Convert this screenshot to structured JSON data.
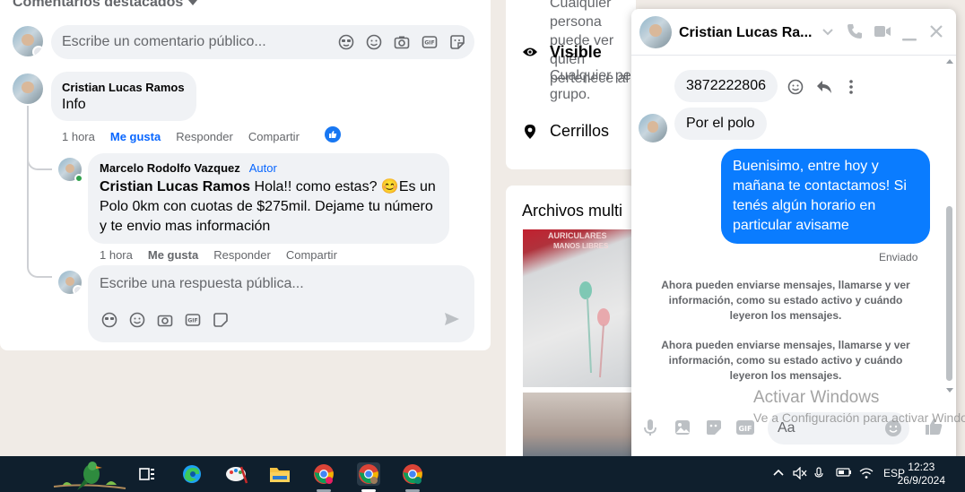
{
  "feed": {
    "section_header": "Comentarios destacados",
    "comment_placeholder": "Escribe un comentario público...",
    "comment1": {
      "author": "Cristian Lucas Ramos",
      "text": "Info",
      "time": "1 hora",
      "like": "Me gusta",
      "reply": "Responder",
      "share": "Compartir"
    },
    "comment2": {
      "author": "Marcelo Rodolfo Vazquez",
      "badge": "Autor",
      "mention": "Cristian Lucas Ramos",
      "text": " Hola!! como estas? 😊Es un Polo 0km con cuotas de $275mil. Dejame tu número y te envio mas información",
      "time": "1 hora",
      "like": "Me gusta",
      "reply": "Responder",
      "share": "Compartir"
    },
    "reply_placeholder": "Escribe una respuesta pública..."
  },
  "group_info": {
    "line_top1": "Cualquier persona puede ver quién",
    "line_top2": "pertenece al",
    "visible_title": "Visible",
    "visible_line1": "Cualquier pe",
    "visible_line2": "grupo.",
    "location": "Cerrillos",
    "media_title": "Archivos multi",
    "photo_text1": "AURICULARES",
    "photo_text2": "MANOS LIBRES"
  },
  "chat": {
    "name": "Cristian Lucas Ra...",
    "msg_phone": "3872222806",
    "msg_polo": "Por el polo",
    "msg_out": "Buenisimo, entre hoy y mañana te contactamos! Si tenés algún horario en particular avisame",
    "sent_status": "Enviado",
    "system1": "Ahora pueden enviarse mensajes, llamarse y ver información, como su estado activo y cuándo leyeron los mensajes.",
    "system2": "Ahora pueden enviarse mensajes, llamarse y ver información, como su estado activo y cuándo leyeron los mensajes.",
    "composer_placeholder": "Aa"
  },
  "watermark": {
    "title": "Activar Windows",
    "subtitle": "Ve a Configuración para activar Windows."
  },
  "taskbar": {
    "language": "ESP",
    "time": "12:23",
    "date": "26/9/2024"
  },
  "colors": {
    "accent": "#0866ff",
    "chat_bubble_out": "#0a7cff",
    "taskbar": "#0f1f2d"
  }
}
